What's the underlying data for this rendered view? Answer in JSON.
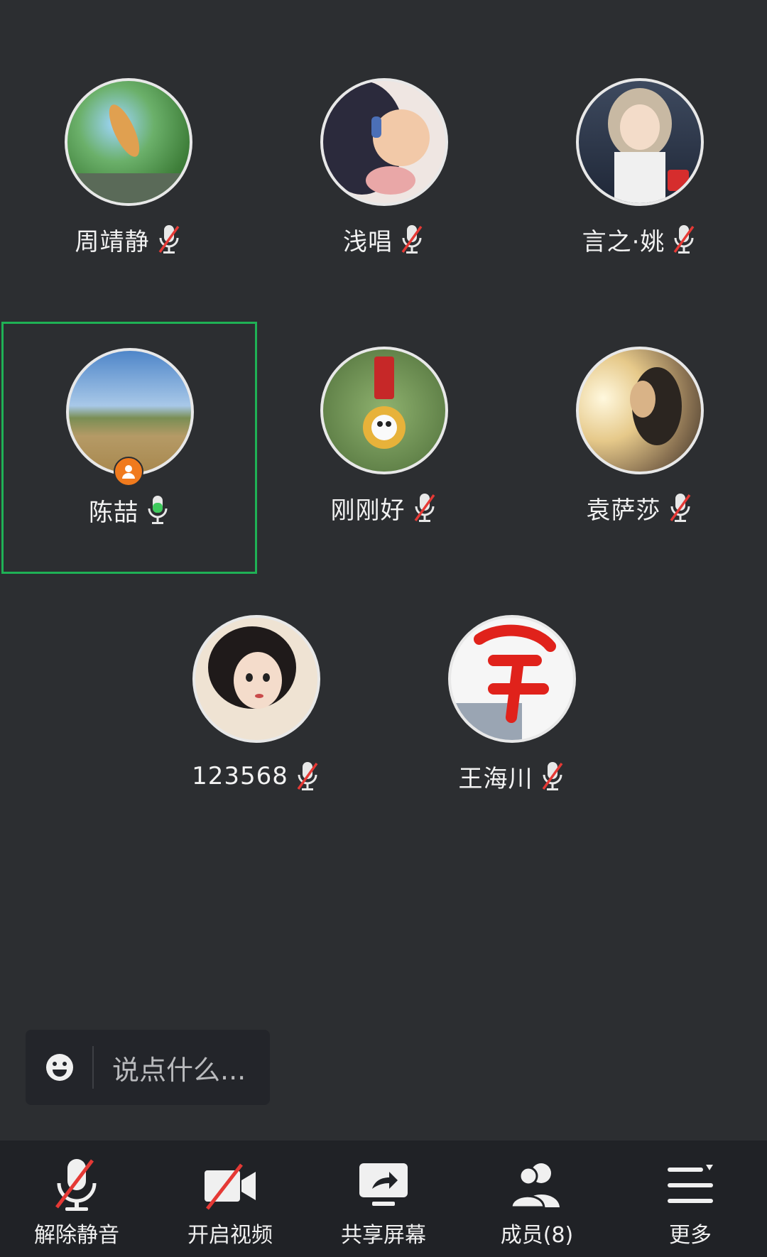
{
  "participants": [
    {
      "name": "周靖静",
      "mic": "muted"
    },
    {
      "name": "浅唱",
      "mic": "muted"
    },
    {
      "name": "言之·姚",
      "mic": "muted"
    },
    {
      "name": "陈喆",
      "mic": "on",
      "host": true,
      "active_speaker": true
    },
    {
      "name": "刚刚好",
      "mic": "muted"
    },
    {
      "name": "袁萨莎",
      "mic": "muted"
    },
    {
      "name": "123568",
      "mic": "muted"
    },
    {
      "name": "王海川",
      "mic": "muted"
    }
  ],
  "chat": {
    "placeholder": "说点什么..."
  },
  "toolbar": {
    "unmute": "解除静音",
    "video": "开启视频",
    "share": "共享屏幕",
    "members": "成员(8)",
    "more": "更多"
  },
  "colors": {
    "background": "#2c2e31",
    "active_border": "#1fb155",
    "mic_on": "#3ec95c",
    "muted_slash": "#e53935",
    "host_badge": "#f07a1d"
  }
}
